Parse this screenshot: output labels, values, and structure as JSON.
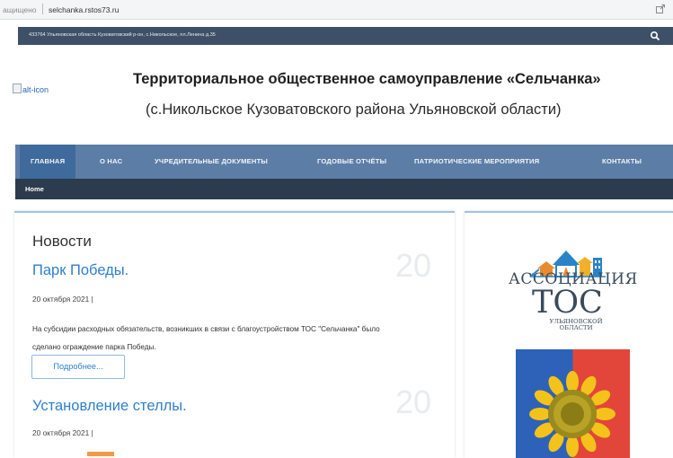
{
  "browser": {
    "secure_label": "ащищено",
    "url": "selchanka.rstos73.ru"
  },
  "topbar": {
    "address": "433764 Ульяновская область Кузоватовский р-он, с.Никольское, пл.Ленина д.35",
    "search_icon": "search-icon"
  },
  "header": {
    "logo_alt": "alt-icon",
    "title": "Территориальное общественное самоуправление «Сельчанка»",
    "subtitle": "(с.Никольское Кузоватовского района Ульяновской области)"
  },
  "nav": {
    "items": [
      {
        "label": "ГЛАВНАЯ"
      },
      {
        "label": "О НАС"
      },
      {
        "label": "УЧРЕДИТЕЛЬНЫЕ ДОКУМЕНТЫ"
      },
      {
        "label": "ГОДОВЫЕ ОТЧЁТЫ"
      },
      {
        "label": "ПАТРИОТИЧЕСКИЕ МЕРОПРИЯТИЯ"
      },
      {
        "label": "КОНТАКТЫ"
      }
    ],
    "active_index": 0
  },
  "breadcrumb": {
    "home": "Home"
  },
  "news": {
    "heading": "Новости",
    "articles": [
      {
        "title": "Парк Победы.",
        "date": "20 октября 2021 |",
        "day_number": "20",
        "text": "На субсидии расходных обязательств, возникших в связи с благоустройством ТОС \"Сельчанка\" было сделано ограждение парка Победы.",
        "more_label": "Подробнее..."
      },
      {
        "title": "Установление стеллы.",
        "date": "20 октября 2021 |",
        "day_number": "20"
      }
    ]
  },
  "sidebar": {
    "assoc_line1": "АССОЦИАЦИЯ",
    "assoc_line2": "ТОС",
    "assoc_line3a": "УЛЬЯНОВСКОЙ",
    "assoc_line3b": "ОБЛАСТИ"
  },
  "colors": {
    "topbar": "#3d5067",
    "nav": "#5c7ea6",
    "nav_active": "#3f6a9c",
    "breadcrumb": "#2c3b4d",
    "link": "#2f7fce"
  }
}
